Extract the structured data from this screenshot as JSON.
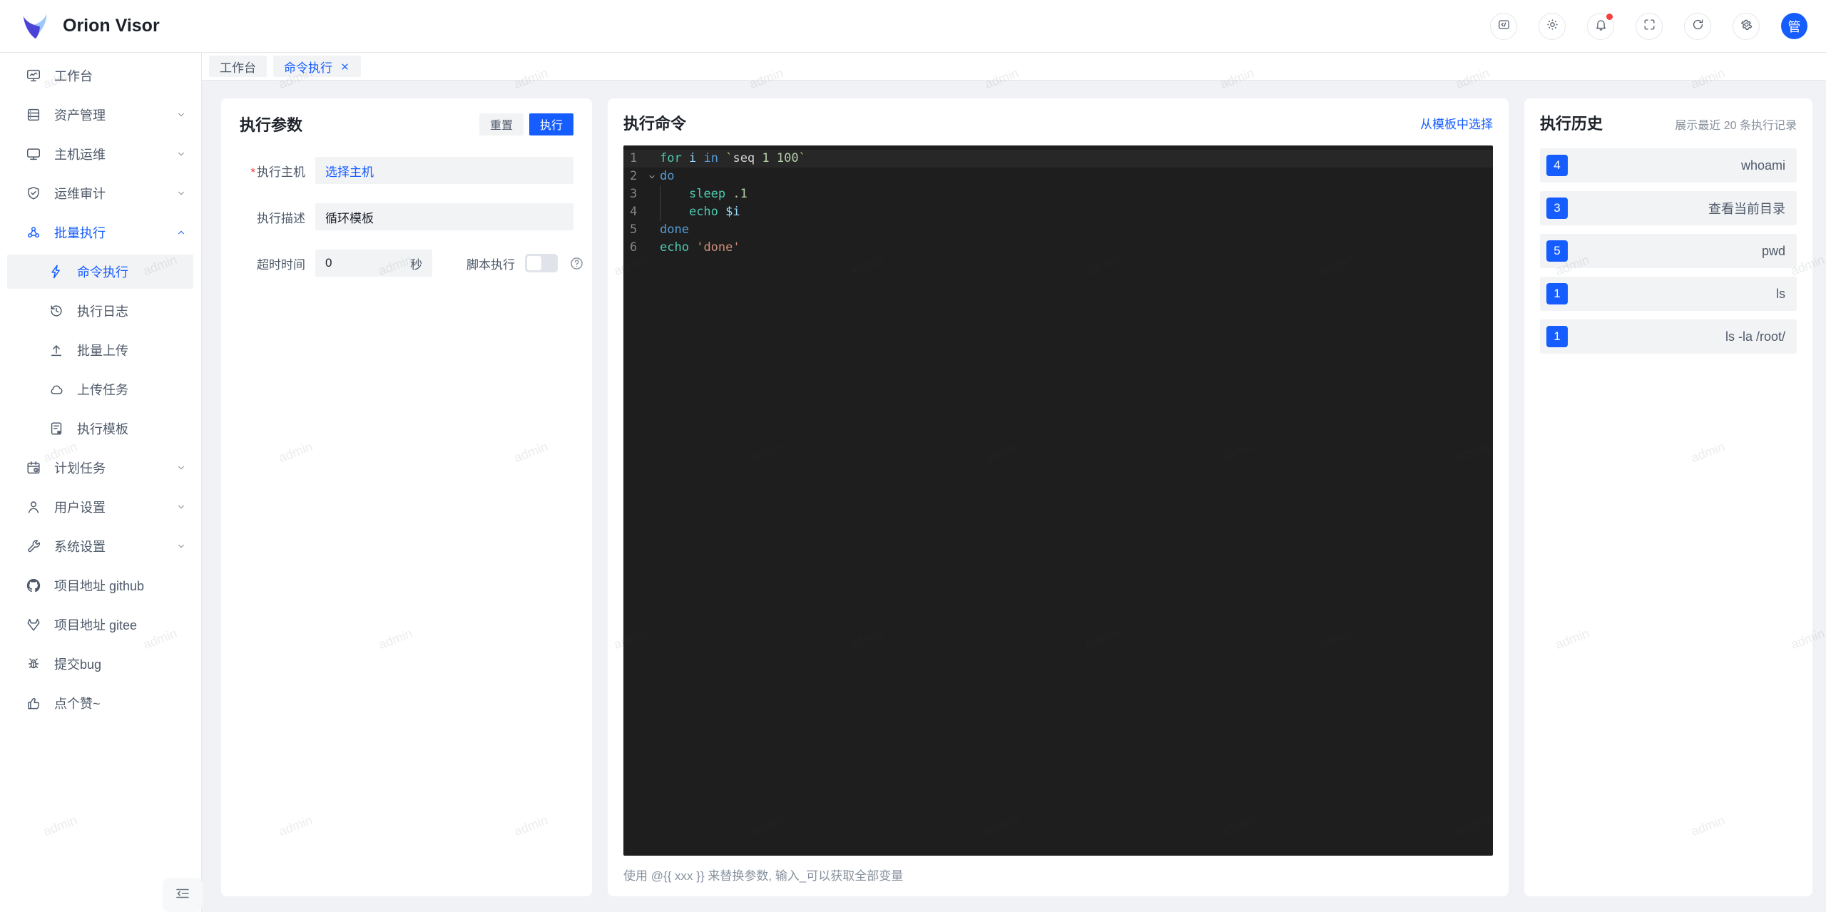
{
  "app": {
    "title": "Orion Visor",
    "avatar_text": "管"
  },
  "colors": {
    "primary": "#165dff",
    "danger": "#f53f3f",
    "editor_bg": "#1e1e1e"
  },
  "header": {
    "icons": [
      "code-console",
      "theme-brightness",
      "notifications-bell",
      "fullscreen",
      "refresh",
      "settings-gear"
    ],
    "has_notification_dot": true
  },
  "sidebar": {
    "items": [
      {
        "key": "workbench",
        "label": "工作台",
        "icon": "workbench",
        "chevron": null
      },
      {
        "key": "assets",
        "label": "资产管理",
        "icon": "assets",
        "chevron": "down"
      },
      {
        "key": "host-ops",
        "label": "主机运维",
        "icon": "host",
        "chevron": "down"
      },
      {
        "key": "ops-audit",
        "label": "运维审计",
        "icon": "audit",
        "chevron": "down"
      },
      {
        "key": "batch-exec",
        "label": "批量执行",
        "icon": "batch",
        "chevron": "up",
        "active": true
      },
      {
        "key": "command-exec",
        "label": "命令执行",
        "icon": "bolt",
        "sub": true,
        "selected": true
      },
      {
        "key": "exec-log",
        "label": "执行日志",
        "icon": "hist",
        "sub": true
      },
      {
        "key": "batch-upload",
        "label": "批量上传",
        "icon": "upload",
        "sub": true
      },
      {
        "key": "upload-task",
        "label": "上传任务",
        "icon": "cloud",
        "sub": true
      },
      {
        "key": "exec-template",
        "label": "执行模板",
        "icon": "template",
        "sub": true
      },
      {
        "key": "schedule",
        "label": "计划任务",
        "icon": "schedule",
        "chevron": "down"
      },
      {
        "key": "user-settings",
        "label": "用户设置",
        "icon": "user",
        "chevron": "down"
      },
      {
        "key": "system-settings",
        "label": "系统设置",
        "icon": "wrench",
        "chevron": "down"
      },
      {
        "key": "github",
        "label": "项目地址 github",
        "icon": "github"
      },
      {
        "key": "gitee",
        "label": "项目地址 gitee",
        "icon": "gitee"
      },
      {
        "key": "bug",
        "label": "提交bug",
        "icon": "bug"
      },
      {
        "key": "like",
        "label": "点个赞~",
        "icon": "like"
      }
    ]
  },
  "tabs": [
    {
      "label": "工作台",
      "active": false,
      "closable": false
    },
    {
      "label": "命令执行",
      "active": true,
      "closable": true
    }
  ],
  "params": {
    "title": "执行参数",
    "reset_label": "重置",
    "run_label": "执行",
    "host_label": "执行主机",
    "host_value": "选择主机",
    "desc_label": "执行描述",
    "desc_value": "循环模板",
    "timeout_label": "超时时间",
    "timeout_value": "0",
    "timeout_unit": "秒",
    "script_label": "脚本执行",
    "script_enabled": false
  },
  "command": {
    "title": "执行命令",
    "template_link": "从模板中选择",
    "hint": "使用 @{{ xxx }} 来替换参数, 输入_可以获取全部变量",
    "code_lines": [
      {
        "num": 1,
        "current": true,
        "tokens": [
          [
            "cmd",
            "for"
          ],
          [
            "pl",
            " "
          ],
          [
            "var",
            "i"
          ],
          [
            "pl",
            " "
          ],
          [
            "kw",
            "in"
          ],
          [
            "pl",
            " "
          ],
          [
            "tick",
            "`"
          ],
          [
            "pl",
            "seq "
          ],
          [
            "num",
            "1 100"
          ],
          [
            "tick",
            "`"
          ]
        ]
      },
      {
        "num": 2,
        "fold": true,
        "tokens": [
          [
            "kw",
            "do"
          ]
        ]
      },
      {
        "num": 3,
        "guide": true,
        "tokens": [
          [
            "pl",
            "    "
          ],
          [
            "cmd",
            "sleep"
          ],
          [
            "pl",
            " "
          ],
          [
            "num",
            ".1"
          ]
        ]
      },
      {
        "num": 4,
        "guide": true,
        "tokens": [
          [
            "pl",
            "    "
          ],
          [
            "cmd",
            "echo"
          ],
          [
            "pl",
            " "
          ],
          [
            "var",
            "$i"
          ]
        ]
      },
      {
        "num": 5,
        "tokens": [
          [
            "kw",
            "done"
          ]
        ]
      },
      {
        "num": 6,
        "tokens": [
          [
            "cmd",
            "echo"
          ],
          [
            "pl",
            " "
          ],
          [
            "str",
            "'done'"
          ]
        ]
      }
    ]
  },
  "history": {
    "title": "执行历史",
    "subtitle": "展示最近 20 条执行记录",
    "records": [
      {
        "count": "4",
        "text": "whoami"
      },
      {
        "count": "3",
        "text": "查看当前目录"
      },
      {
        "count": "5",
        "text": "pwd"
      },
      {
        "count": "1",
        "text": "ls"
      },
      {
        "count": "1",
        "text": "ls -la /root/"
      }
    ]
  },
  "watermark": {
    "text": "admin"
  }
}
